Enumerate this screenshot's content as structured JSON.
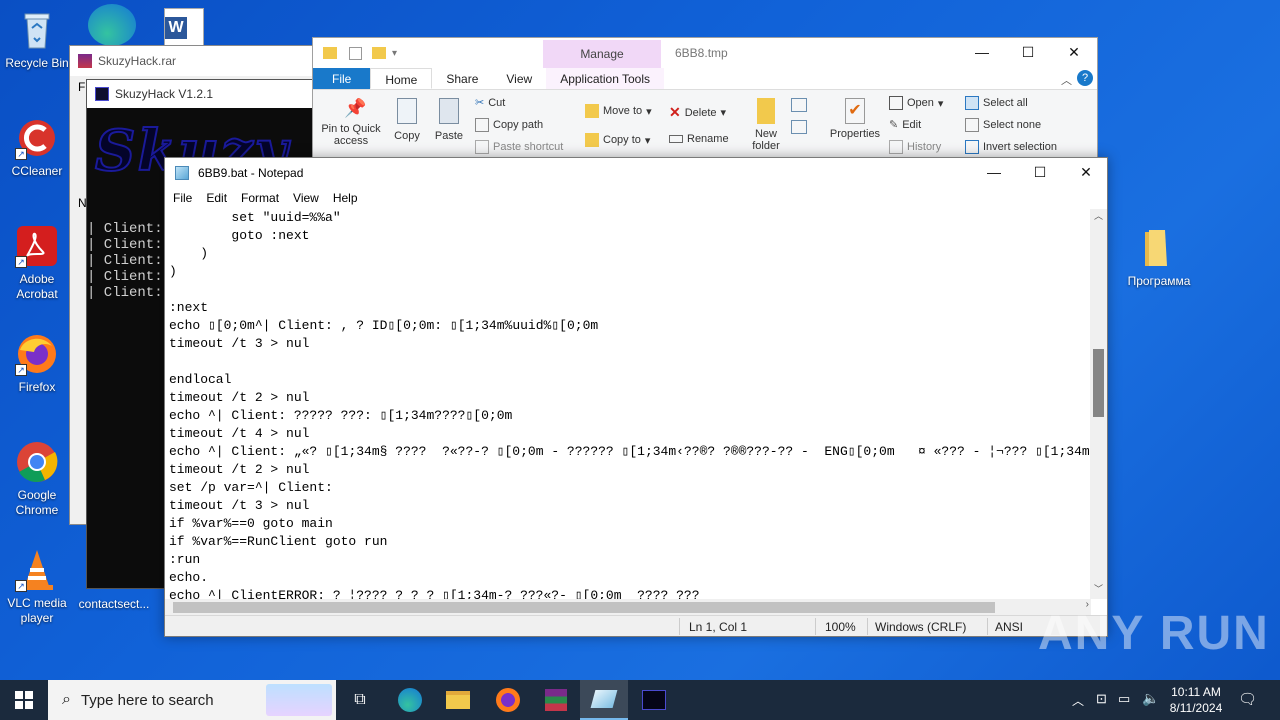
{
  "desktop": {
    "icons": [
      {
        "label": "Recycle Bin"
      },
      {
        "label": "CCleaner"
      },
      {
        "label": "Adobe Acrobat"
      },
      {
        "label": "Firefox"
      },
      {
        "label": "Google Chrome"
      },
      {
        "label": "VLC media player"
      },
      {
        "label": "contactsect..."
      },
      {
        "label": "Программа"
      }
    ]
  },
  "winrar": {
    "title": "SkuzyHack.rar",
    "menu_hint": "Fi",
    "list_hint": "N"
  },
  "hack_window": {
    "title": "SkuzyHack V1.2.1",
    "logo_text": "Skuzy",
    "lines": [
      "| Client:",
      "| Client:",
      "| Client:",
      "| Client:",
      "| Client:"
    ]
  },
  "explorer": {
    "title": "6BB8.tmp",
    "manage_tab": "Manage",
    "tabs": {
      "file": "File",
      "home": "Home",
      "share": "Share",
      "view": "View",
      "app_tools": "Application Tools"
    },
    "ribbon": {
      "pin": "Pin to Quick access",
      "copy": "Copy",
      "paste": "Paste",
      "cut": "Cut",
      "copy_path": "Copy path",
      "paste_shortcut": "Paste shortcut",
      "move_to": "Move to",
      "copy_to": "Copy to",
      "delete": "Delete",
      "rename": "Rename",
      "new_folder": "New folder",
      "properties": "Properties",
      "open": "Open",
      "edit": "Edit",
      "history": "History",
      "select_all": "Select all",
      "select_none": "Select none",
      "invert_selection": "Invert selection"
    }
  },
  "notepad": {
    "title": "6BB9.bat - Notepad",
    "menu": [
      "File",
      "Edit",
      "Format",
      "View",
      "Help"
    ],
    "lines": [
      "        set \"uuid=%%a\"",
      "        goto :next",
      "    )",
      ")",
      "",
      ":next",
      "echo ▯[0;0m^| Client: , ? ID▯[0;0m: ▯[1;34m%uuid%▯[0;0m",
      "timeout /t 3 > nul",
      "",
      "endlocal",
      "timeout /t 2 > nul",
      "echo ^| Client: ????? ???: ▯[1;34m????▯[0;0m",
      "timeout /t 4 > nul",
      "echo ^| Client: „«? ▯[1;34m§ ????  ?«??-? ▯[0;0m - ?????? ▯[1;34m‹??®? ?®®???-?? -  ENG▯[0;0m   ¤ «??? - ¦¬??? ▯[1;34m",
      "timeout /t 2 > nul",
      "set /p var=^| Client:",
      "timeout /t 3 > nul",
      "if %var%==0 goto main",
      "if %var%==RunClient goto run",
      ":run",
      "echo.",
      "echo ^| ClientERROR: ? ¦???? ? ? ? ▯[1;34m-? ???«?- ▯[0;0m  ???? ???"
    ],
    "status": {
      "position": "Ln 1, Col 1",
      "zoom": "100%",
      "line_ending": "Windows (CRLF)",
      "encoding": "ANSI"
    }
  },
  "taskbar": {
    "search_placeholder": "Type here to search",
    "time": "10:11 AM",
    "date": "8/11/2024"
  },
  "watermark": "ANY RUN"
}
